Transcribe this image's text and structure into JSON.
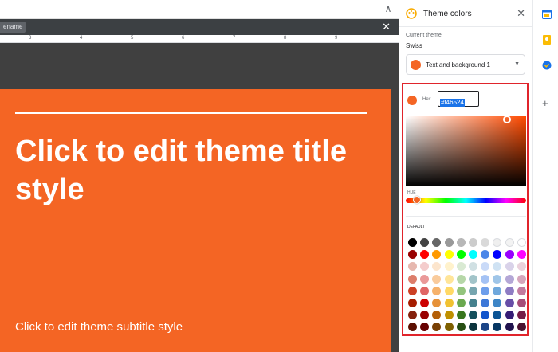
{
  "editor": {
    "tab_label": "ename",
    "close_symbol": "✕",
    "collapse_symbol": "∧",
    "ruler_ticks": [
      "3",
      "4",
      "5",
      "6",
      "7",
      "8",
      "9"
    ],
    "slide": {
      "title": "Click to edit theme title style",
      "subtitle": "Click to edit theme subtitle style",
      "background_color": "#f46524"
    }
  },
  "panel": {
    "title": "Theme colors",
    "close_symbol": "✕",
    "current_theme_label": "Current theme",
    "current_theme_value": "Swiss",
    "select": {
      "value": "Text and background 1",
      "caret": "▼"
    },
    "picker": {
      "hex_label": "Hex",
      "hex_value": "#f46524",
      "hue_label": "HUE",
      "default_label": "DEFAULT"
    },
    "palette_rows": [
      [
        "#000000",
        "#434343",
        "#666666",
        "#999999",
        "#b7b7b7",
        "#cccccc",
        "#d9d9d9",
        "#efefef",
        "#f3f3f3",
        "#ffffff"
      ],
      [
        "#980000",
        "#ff0000",
        "#ff9900",
        "#ffff00",
        "#00ff00",
        "#00ffff",
        "#4a86e8",
        "#0000ff",
        "#9900ff",
        "#ff00ff"
      ],
      [
        "#e6b8af",
        "#f4cccc",
        "#fce5cd",
        "#fff2cc",
        "#d9ead3",
        "#d0e0e3",
        "#c9daf8",
        "#cfe2f3",
        "#d9d2e9",
        "#ead1dc"
      ],
      [
        "#dd7e6b",
        "#ea9999",
        "#f9cb9c",
        "#ffe599",
        "#b6d7a8",
        "#a2c4c9",
        "#a4c2f4",
        "#9fc5e8",
        "#b4a7d6",
        "#d5a6bd"
      ],
      [
        "#cc4125",
        "#e06666",
        "#f6b26b",
        "#ffd966",
        "#93c47d",
        "#76a5af",
        "#6d9eeb",
        "#6fa8dc",
        "#8e7cc3",
        "#c27ba0"
      ],
      [
        "#a61c00",
        "#cc0000",
        "#e69138",
        "#f1c232",
        "#6aa84f",
        "#45818e",
        "#3c78d8",
        "#3d85c6",
        "#674ea7",
        "#a64d79"
      ],
      [
        "#85200c",
        "#990000",
        "#b45f06",
        "#bf9000",
        "#38761d",
        "#134f5c",
        "#1155cc",
        "#0b5394",
        "#351c75",
        "#741b47"
      ],
      [
        "#5b0f00",
        "#660000",
        "#783f04",
        "#7f6000",
        "#274e13",
        "#0c343d",
        "#1c4587",
        "#073763",
        "#20124d",
        "#4c1130"
      ]
    ]
  },
  "rail": {
    "icons": [
      "calendar-icon",
      "keep-icon",
      "tasks-icon"
    ],
    "add_symbol": "+"
  }
}
